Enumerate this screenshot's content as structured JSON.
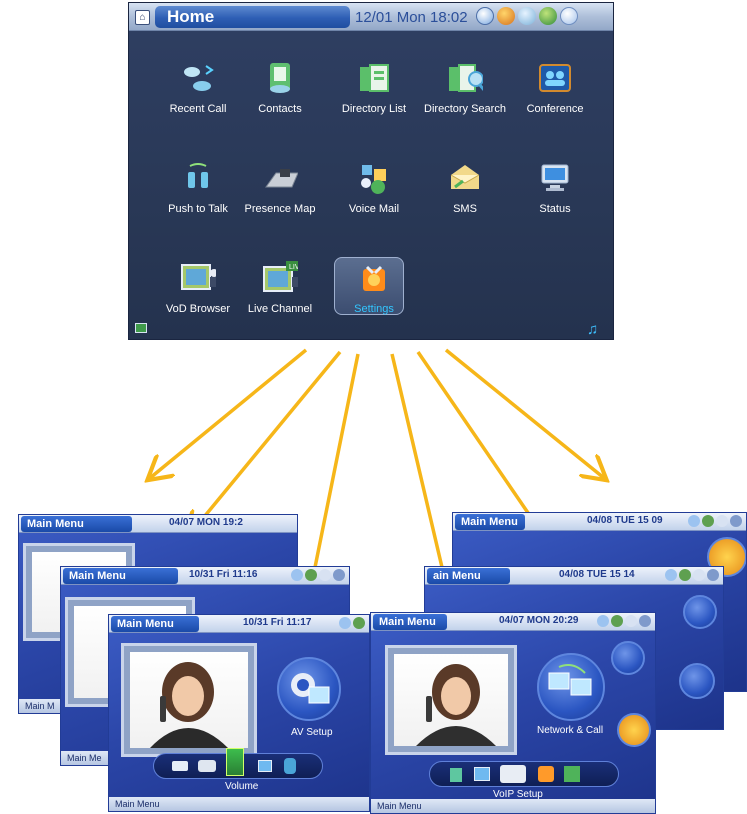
{
  "home": {
    "title": "Home",
    "datetime": "12/01 Mon 18:02",
    "apps": [
      {
        "label": "Recent Call",
        "icon": "recent-call-icon"
      },
      {
        "label": "Contacts",
        "icon": "contacts-icon"
      },
      {
        "label": "Directory List",
        "icon": "directory-list-icon"
      },
      {
        "label": "Directory Search",
        "icon": "directory-search-icon"
      },
      {
        "label": "Conference",
        "icon": "conference-icon"
      },
      {
        "label": "Push to Talk",
        "icon": "push-to-talk-icon"
      },
      {
        "label": "Presence Map",
        "icon": "presence-map-icon"
      },
      {
        "label": "Voice Mail",
        "icon": "voice-mail-icon"
      },
      {
        "label": "SMS",
        "icon": "sms-icon"
      },
      {
        "label": "Status",
        "icon": "status-icon"
      },
      {
        "label": "VoD Browser",
        "icon": "vod-browser-icon"
      },
      {
        "label": "Live Channel",
        "icon": "live-channel-icon"
      },
      {
        "label": "Settings",
        "icon": "settings-icon"
      }
    ],
    "selected": "Settings",
    "accent": "#33c6ff"
  },
  "screens": {
    "left_back": {
      "title": "Main Menu",
      "datetime": "04/07 MON 19:2",
      "footer": "Main M"
    },
    "left_mid": {
      "title": "Main Menu",
      "datetime": "10/31 Fri 11:16",
      "footer": "Main Me"
    },
    "left_front": {
      "title": "Main Menu",
      "datetime": "10/31 Fri 11:17",
      "footer": "Main Menu",
      "center_label": "AV Setup",
      "dock_label": "Volume"
    },
    "right_back": {
      "title": "Main Menu",
      "datetime": "04/08 TUE 15 09"
    },
    "right_mid": {
      "title": "ain Menu",
      "datetime": "04/08 TUE 15 14"
    },
    "right_front": {
      "title": "Main Menu",
      "datetime": "04/07 MON 20:29",
      "footer": "Main Menu",
      "center_label": "Network & Call",
      "dock_label": "VoIP Setup"
    }
  },
  "colors": {
    "arrow": "#f6b619",
    "screen_blue": "#2b46a8",
    "home_bg": "#2b3a5a"
  }
}
